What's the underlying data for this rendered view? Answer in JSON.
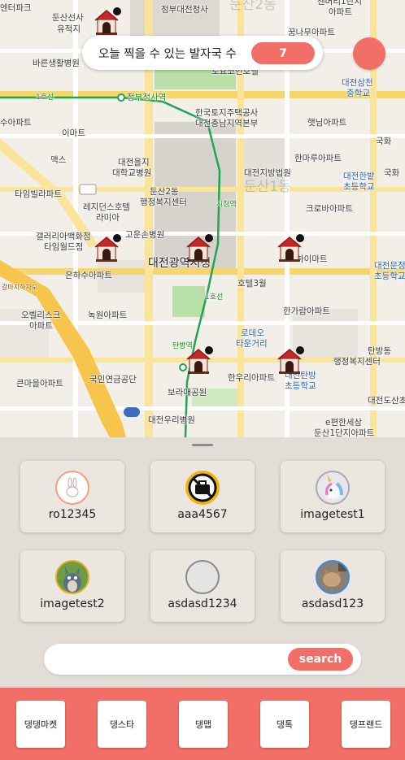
{
  "counter": {
    "label": "오늘 찍을 수 있는 발자국 수",
    "value": "7"
  },
  "map": {
    "labels": [
      "엔터파크",
      "둔산선사",
      "유적지",
      "정부대전청사",
      "둔산2동",
      "센머리1단지",
      "아파트",
      "꿈나무아파트",
      "바른생활병원",
      "토요코인호텔",
      "대전삼천",
      "중학교",
      "1호선",
      "정부청사역",
      "한국토지주택공사",
      "대전충남지역본부",
      "수아파트",
      "햇님아파트",
      "이마트",
      "맥스",
      "대전을지",
      "대학교병원",
      "국화",
      "한마루아파트",
      "대전지방법원",
      "대전한밭",
      "초등학교",
      "국화",
      "타임빌라파트",
      "레지던스호텔",
      "라미아",
      "둔산2동",
      "행정복지센터",
      "크로바아파트",
      "갤러리아백화점",
      "타임월드점",
      "고운손병원",
      "대전광역시청",
      "하이마트",
      "대전문정",
      "초등학교",
      "은하수아파트",
      "호텔3월",
      "갈마지하차도",
      "오벨리스크",
      "아파트",
      "녹원아파트",
      "한가람아파트",
      "로데오",
      "타운거리",
      "탄방동",
      "행정복지센터",
      "국민연금공단",
      "한우리아파트",
      "대전탄방",
      "초등학교",
      "큰마을아파트",
      "보라매공원",
      "대전도산초",
      "대전우리병원",
      "e편한세상",
      "둔산1단지아파트",
      "시청역",
      "탄방역",
      "둔산1동",
      "1호선"
    ]
  },
  "users": [
    {
      "name": "ro12345",
      "avatar": "rabbit-sketch-avatar"
    },
    {
      "name": "aaa4567",
      "avatar": "no-briefcase-avatar"
    },
    {
      "name": "imagetest1",
      "avatar": "unicorn-avatar"
    },
    {
      "name": "imagetest2",
      "avatar": "totoro-avatar"
    },
    {
      "name": "asdasd1234",
      "avatar": "empty-avatar"
    },
    {
      "name": "asdasd123",
      "avatar": "cat-photo-avatar"
    }
  ],
  "search": {
    "placeholder": "",
    "value": "",
    "button_label": "search"
  },
  "nav": [
    {
      "label": "댕댕마켓"
    },
    {
      "label": "댕스타"
    },
    {
      "label": "댕맵"
    },
    {
      "label": "댕톡"
    },
    {
      "label": "댕프랜드"
    }
  ],
  "colors": {
    "accent": "#f26f67",
    "panel_bg": "#e2ddd7",
    "card_bg": "#ece6e1"
  }
}
